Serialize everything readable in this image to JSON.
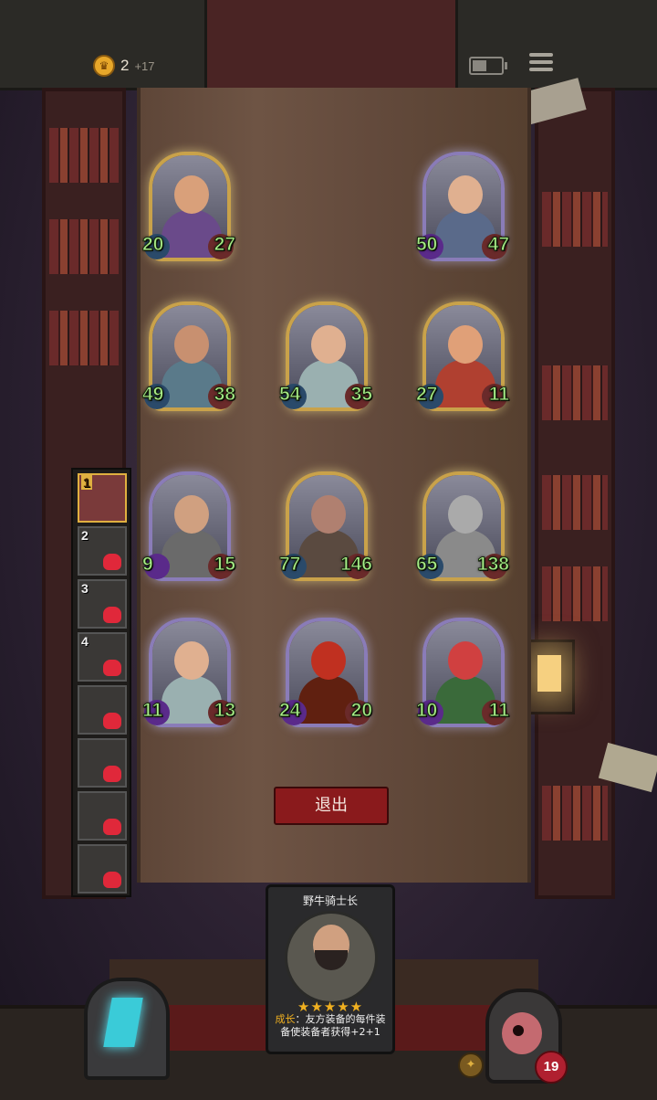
{
  "topbar": {
    "gold": "2",
    "gold_income": "+17",
    "icons": {
      "coin": "crown-coin-icon",
      "battery": "battery-icon",
      "menu": "menu-icon"
    },
    "battery_level": 0.55
  },
  "board": {
    "minions": [
      {
        "id": "m1",
        "attack": "20",
        "health": "27",
        "frame": "gold",
        "art": "old-bearded-lumberjack",
        "colors": {
          "skin": "#d9a07a",
          "body": "#6a4a8a"
        }
      },
      {
        "id": "m2",
        "attack": "50",
        "health": "47",
        "frame": "purple",
        "art": "helmeted-warrior",
        "colors": {
          "skin": "#e0b090",
          "body": "#5a6a8a"
        }
      },
      {
        "id": "m3",
        "attack": "49",
        "health": "38",
        "frame": "gold",
        "art": "plaid-shirt-brute",
        "colors": {
          "skin": "#c89070",
          "body": "#5a7a8a"
        }
      },
      {
        "id": "m4",
        "attack": "54",
        "health": "35",
        "frame": "gold",
        "art": "shield-bearer",
        "colors": {
          "skin": "#e0b090",
          "body": "#9ab0b0"
        }
      },
      {
        "id": "m5",
        "attack": "27",
        "health": "11",
        "frame": "gold",
        "art": "blond-tough-guy",
        "colors": {
          "skin": "#e0a078",
          "body": "#b04030"
        }
      },
      {
        "id": "m6",
        "attack": "9",
        "health": "15",
        "frame": "purple",
        "art": "armored-knight-captain",
        "colors": {
          "skin": "#d0a080",
          "body": "#6a6a6a"
        }
      },
      {
        "id": "m7",
        "attack": "77",
        "health": "146",
        "frame": "gold",
        "art": "bald-monk",
        "colors": {
          "skin": "#b08070",
          "body": "#5a4a40"
        }
      },
      {
        "id": "m8",
        "attack": "65",
        "health": "138",
        "frame": "gold",
        "art": "steel-helm-knight",
        "colors": {
          "skin": "#aaaaaa",
          "body": "#8a8a8a"
        }
      },
      {
        "id": "m9",
        "attack": "11",
        "health": "13",
        "frame": "purple",
        "art": "shield-bearer",
        "colors": {
          "skin": "#e0b090",
          "body": "#9ab0b0"
        }
      },
      {
        "id": "m10",
        "attack": "24",
        "health": "20",
        "frame": "purple",
        "art": "fire-dragon",
        "colors": {
          "skin": "#c03020",
          "body": "#602010"
        }
      },
      {
        "id": "m11",
        "attack": "10",
        "health": "11",
        "frame": "purple",
        "art": "grinning-red-imp",
        "colors": {
          "skin": "#d04040",
          "body": "#3a6a3a"
        }
      }
    ]
  },
  "sidelist": {
    "slots": [
      {
        "num": "1",
        "defeated": false
      },
      {
        "num": "2",
        "defeated": true
      },
      {
        "num": "3",
        "defeated": true
      },
      {
        "num": "4",
        "defeated": true
      },
      {
        "num": "",
        "defeated": true
      },
      {
        "num": "",
        "defeated": true
      },
      {
        "num": "",
        "defeated": true
      },
      {
        "num": "",
        "defeated": true
      }
    ]
  },
  "quit_button": {
    "label": "退出"
  },
  "hero_card": {
    "title": "野牛骑士长",
    "stars": "★★★★★",
    "keyword": "成长",
    "description": "：友方装备的每件装备使装备者获得+2+1"
  },
  "player": {
    "health": "19"
  },
  "colors": {
    "accent_gold": "#c9a24a",
    "quit_red": "#8a1a1c",
    "stat_green": "#a8ee88"
  }
}
